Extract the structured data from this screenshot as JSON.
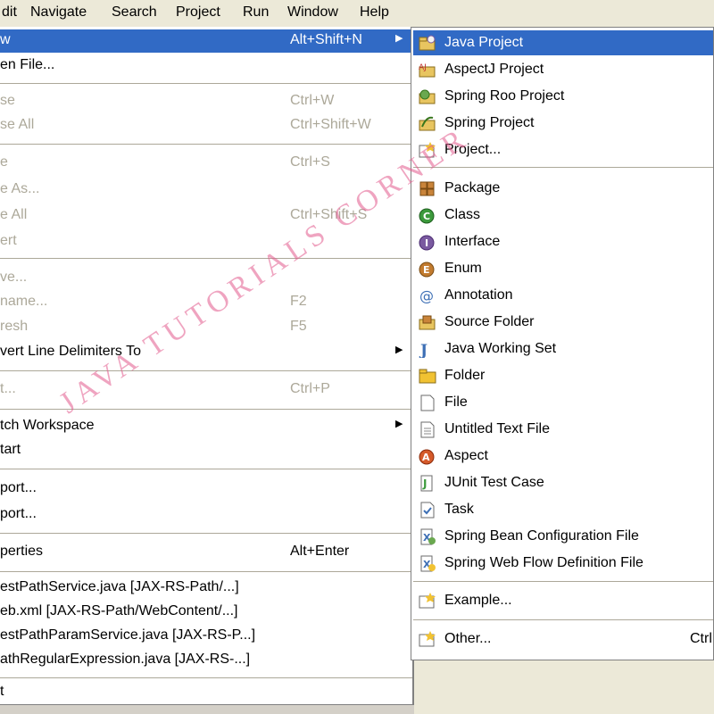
{
  "colors": {
    "menu_bg": "#ffffff",
    "selection": "#316ac5",
    "disabled_text": "#aca899",
    "toolbar_bg": "#ece9d8",
    "watermark": "#e25a8c"
  },
  "menubar": {
    "items": [
      "dit",
      "Navigate",
      "Search",
      "Project",
      "Run",
      "Window",
      "Help"
    ]
  },
  "file_menu": {
    "items": [
      {
        "label": "w",
        "accel": "Alt+Shift+N",
        "submenu": true,
        "selected": true
      },
      {
        "label": "en File...",
        "accel": ""
      },
      {
        "label": "se",
        "accel": "Ctrl+W",
        "disabled": true
      },
      {
        "label": "se All",
        "accel": "Ctrl+Shift+W",
        "disabled": true
      },
      {
        "label": "e",
        "accel": "Ctrl+S",
        "disabled": true
      },
      {
        "label": "e As...",
        "accel": "",
        "disabled": true
      },
      {
        "label": "e All",
        "accel": "Ctrl+Shift+S",
        "disabled": true
      },
      {
        "label": "ert",
        "accel": "",
        "disabled": true
      },
      {
        "label": "ve...",
        "accel": "",
        "disabled": true
      },
      {
        "label": "name...",
        "accel": "F2",
        "disabled": true
      },
      {
        "label": "resh",
        "accel": "F5",
        "disabled": true
      },
      {
        "label": "vert Line Delimiters To",
        "accel": "",
        "submenu": true
      },
      {
        "label": "t...",
        "accel": "Ctrl+P",
        "disabled": true
      },
      {
        "label": "tch Workspace",
        "accel": "",
        "submenu": true
      },
      {
        "label": "tart",
        "accel": ""
      },
      {
        "label": "port...",
        "accel": ""
      },
      {
        "label": "port...",
        "accel": ""
      },
      {
        "label": "perties",
        "accel": "Alt+Enter"
      },
      {
        "label": "estPathService.java  [JAX-RS-Path/...]",
        "accel": ""
      },
      {
        "label": "eb.xml  [JAX-RS-Path/WebContent/...]",
        "accel": ""
      },
      {
        "label": "estPathParamService.java  [JAX-RS-P...]",
        "accel": ""
      },
      {
        "label": "athRegularExpression.java  [JAX-RS-...]",
        "accel": ""
      },
      {
        "label": "t",
        "accel": ""
      }
    ]
  },
  "new_submenu": {
    "items": [
      {
        "label": "Java Project",
        "icon": "java-project-icon",
        "selected": true
      },
      {
        "label": "AspectJ Project",
        "icon": "aspectj-project-icon"
      },
      {
        "label": "Spring Roo Project",
        "icon": "spring-roo-project-icon"
      },
      {
        "label": "Spring Project",
        "icon": "spring-project-icon"
      },
      {
        "label": "Project...",
        "icon": "project-icon"
      },
      {
        "label": "Package",
        "icon": "package-icon"
      },
      {
        "label": "Class",
        "icon": "class-icon"
      },
      {
        "label": "Interface",
        "icon": "interface-icon"
      },
      {
        "label": "Enum",
        "icon": "enum-icon"
      },
      {
        "label": "Annotation",
        "icon": "annotation-icon"
      },
      {
        "label": "Source Folder",
        "icon": "source-folder-icon"
      },
      {
        "label": "Java Working Set",
        "icon": "working-set-icon"
      },
      {
        "label": "Folder",
        "icon": "folder-icon"
      },
      {
        "label": "File",
        "icon": "file-icon"
      },
      {
        "label": "Untitled Text File",
        "icon": "text-file-icon"
      },
      {
        "label": "Aspect",
        "icon": "aspect-icon"
      },
      {
        "label": "JUnit Test Case",
        "icon": "junit-icon"
      },
      {
        "label": "Task",
        "icon": "task-icon"
      },
      {
        "label": "Spring Bean Configuration File",
        "icon": "spring-bean-icon"
      },
      {
        "label": "Spring Web Flow Definition File",
        "icon": "spring-webflow-icon"
      },
      {
        "label": "Example...",
        "icon": "example-icon"
      },
      {
        "label": "Other...",
        "icon": "other-icon",
        "accel": "Ctrl"
      }
    ]
  },
  "watermark": {
    "text": "JAVA TUTORIALS CORNER"
  }
}
